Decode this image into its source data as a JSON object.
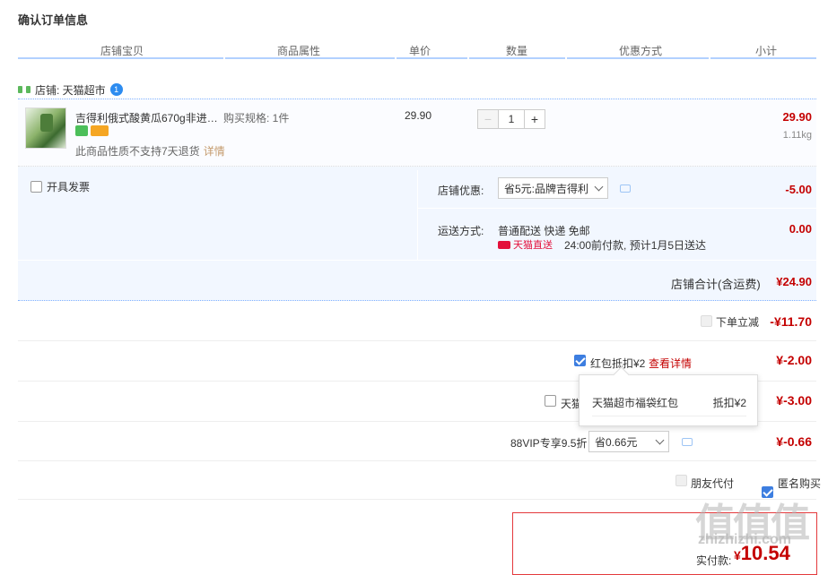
{
  "page_title": "确认订单信息",
  "columns": [
    "店铺宝贝",
    "商品属性",
    "单价",
    "数量",
    "优惠方式",
    "小计"
  ],
  "shop": {
    "label": "店铺: 天猫超市",
    "badge": "1"
  },
  "item": {
    "title": "吉得利俄式酸黄瓜670g非进口...",
    "attr": "购买规格: 1件",
    "unit_price": "29.90",
    "qty_minus": "−",
    "qty": "1",
    "qty_plus": "+",
    "subtotal": "29.90",
    "weight": "1.11kg",
    "no_return": "此商品性质不支持7天退货",
    "detail_link": "详情"
  },
  "invoice": {
    "label": "开具发票"
  },
  "shop_promo": {
    "label": "店铺优惠:",
    "selected": "省5元:品牌吉得利",
    "amount": "-5.00"
  },
  "shipping": {
    "label": "运送方式:",
    "method": "普通配送 快递 免邮",
    "tmall_tag": "天猫直送",
    "eta": "24:00前付款, 预计1月5日送达",
    "amount": "0.00"
  },
  "shop_total": {
    "label": "店铺合计(含运费)",
    "amount": "¥24.90"
  },
  "discount_order": {
    "label": "下单立减",
    "amount": "-¥11.70"
  },
  "red_packet": {
    "label": "红包抵扣¥2",
    "link": "查看详情",
    "amount": "¥-2.00"
  },
  "tmall_row": {
    "label": "天猫",
    "amount": "¥-3.00"
  },
  "popup": {
    "name": "天猫超市福袋红包",
    "value": "抵扣¥2"
  },
  "vip": {
    "label": "88VIP专享9.5折",
    "selected": "省0.66元",
    "amount": "¥-0.66"
  },
  "options": {
    "friend_pay": "朋友代付",
    "anonymous": "匿名购买"
  },
  "pay": {
    "label": "实付款:",
    "currency": "¥",
    "amount": "10.54"
  },
  "watermark": {
    "big": "值值值",
    "small": "zhizhizhi.com"
  }
}
